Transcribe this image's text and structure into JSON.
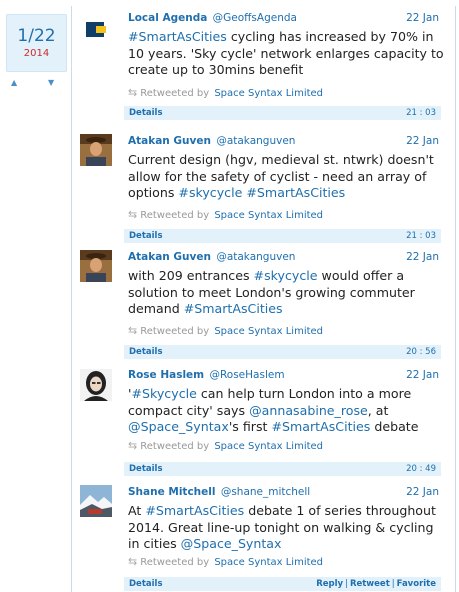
{
  "date_box": {
    "date": "1/22",
    "year": "2014"
  },
  "nav": {
    "up": "▲",
    "down": "▼"
  },
  "tweets": [
    {
      "name": "Local Agenda",
      "handle": "@GeoffsAgenda",
      "date": "22 Jan",
      "avatar": "local-agenda-logo",
      "body": [
        {
          "t": "#SmartAsCities",
          "h": true
        },
        {
          "t": " cycling has increased by 70% in 10 years. 'Sky cycle' network enlarges capacity to create up to 30mins benefit",
          "h": false
        }
      ],
      "retweet_prefix": "Retweeted by",
      "retweeted_by": "Space Syntax Limited",
      "details": "Details",
      "time": "21 : 03"
    },
    {
      "name": "Atakan Guven",
      "handle": "@atakanguven",
      "date": "22 Jan",
      "avatar": "man-portrait",
      "body": [
        {
          "t": "Current design (hgv, medieval st. ntwrk) doesn't allow for the safety of cyclist - need an array of options ",
          "h": false
        },
        {
          "t": "#skycycle",
          "h": true
        },
        {
          "t": " ",
          "h": false
        },
        {
          "t": "#SmartAsCities",
          "h": true
        }
      ],
      "retweet_prefix": "Retweeted by",
      "retweeted_by": "Space Syntax Limited",
      "details": "Details",
      "time": "21 : 03"
    },
    {
      "name": "Atakan Guven",
      "handle": "@atakanguven",
      "date": "22 Jan",
      "avatar": "man-portrait",
      "body": [
        {
          "t": "with 209 entrances ",
          "h": false
        },
        {
          "t": "#skycycle",
          "h": true
        },
        {
          "t": " would offer a solution to meet London's growing commuter demand ",
          "h": false
        },
        {
          "t": "#SmartAsCities",
          "h": true
        }
      ],
      "retweet_prefix": "Retweeted by",
      "retweeted_by": "Space Syntax Limited",
      "details": "Details",
      "time": "20 : 56"
    },
    {
      "name": "Rose Haslem",
      "handle": "@RoseHaslem",
      "date": "22 Jan",
      "avatar": "woman-portrait",
      "body": [
        {
          "t": "'",
          "h": false
        },
        {
          "t": "#Skycycle",
          "h": true
        },
        {
          "t": " can help turn London into a more compact city' says ",
          "h": false
        },
        {
          "t": "@annasabine_rose",
          "h": true
        },
        {
          "t": ", at ",
          "h": false
        },
        {
          "t": "@Space_Syntax",
          "h": true
        },
        {
          "t": "'s first ",
          "h": false
        },
        {
          "t": "#SmartAsCities",
          "h": true
        },
        {
          "t": " debate",
          "h": false
        }
      ],
      "retweet_prefix": "Retweeted by",
      "retweeted_by": "Space Syntax Limited",
      "details": "Details",
      "time": "20 : 49"
    },
    {
      "name": "Shane Mitchell",
      "handle": "@shane_mitchell",
      "date": "22 Jan",
      "avatar": "landscape-photo",
      "body": [
        {
          "t": "At ",
          "h": false
        },
        {
          "t": "#SmartAsCities",
          "h": true
        },
        {
          "t": " debate 1 of series throughout 2014. Great line-up tonight on walking & cycling in cities ",
          "h": false
        },
        {
          "t": "@Space_Syntax",
          "h": true
        }
      ],
      "retweet_prefix": "Retweeted by",
      "retweeted_by": "Space Syntax Limited",
      "details": "Details",
      "actions": [
        "Reply",
        "Retweet",
        "Favorite"
      ]
    }
  ]
}
